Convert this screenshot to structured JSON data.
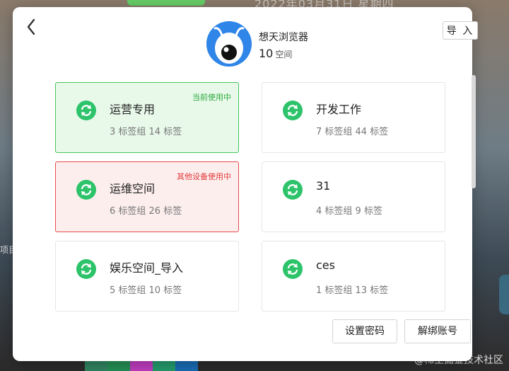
{
  "background": {
    "date_text": "2022年03月31日 星期四",
    "left_text": "项目",
    "watermark": "@稀土掘金技术社区"
  },
  "dialog": {
    "import_label": "导 入",
    "profile": {
      "name": "想天浏览器",
      "space_count": "10",
      "space_unit": "空间"
    },
    "cards": [
      {
        "name": "运营专用",
        "stats": "3 标签组 14 标签",
        "badge": "当前使用中",
        "state": "active"
      },
      {
        "name": "开发工作",
        "stats": "7 标签组 44 标签",
        "badge": "",
        "state": "normal"
      },
      {
        "name": "运维空间",
        "stats": "6 标签组 26 标签",
        "badge": "其他设备使用中",
        "state": "other"
      },
      {
        "name": "31",
        "stats": "4 标签组 9 标签",
        "badge": "",
        "state": "normal"
      },
      {
        "name": "娱乐空间_导入",
        "stats": "5 标签组 10 标签",
        "badge": "",
        "state": "normal"
      },
      {
        "name": "ces",
        "stats": "1 标签组 13 标签",
        "badge": "",
        "state": "normal"
      }
    ],
    "buttons": {
      "set_password": "设置密码",
      "unbind": "解绑账号"
    },
    "icons": {
      "back": "chevron-left-icon",
      "space": "sync-icon",
      "avatar": "ant-mascot"
    },
    "colors": {
      "accent_green": "#2dc36a",
      "active_bg": "#e8f9ea",
      "active_border": "#45c35a",
      "other_bg": "#fdeeee",
      "other_border": "#ea4a4a",
      "avatar_blue": "#2f86e8"
    }
  }
}
